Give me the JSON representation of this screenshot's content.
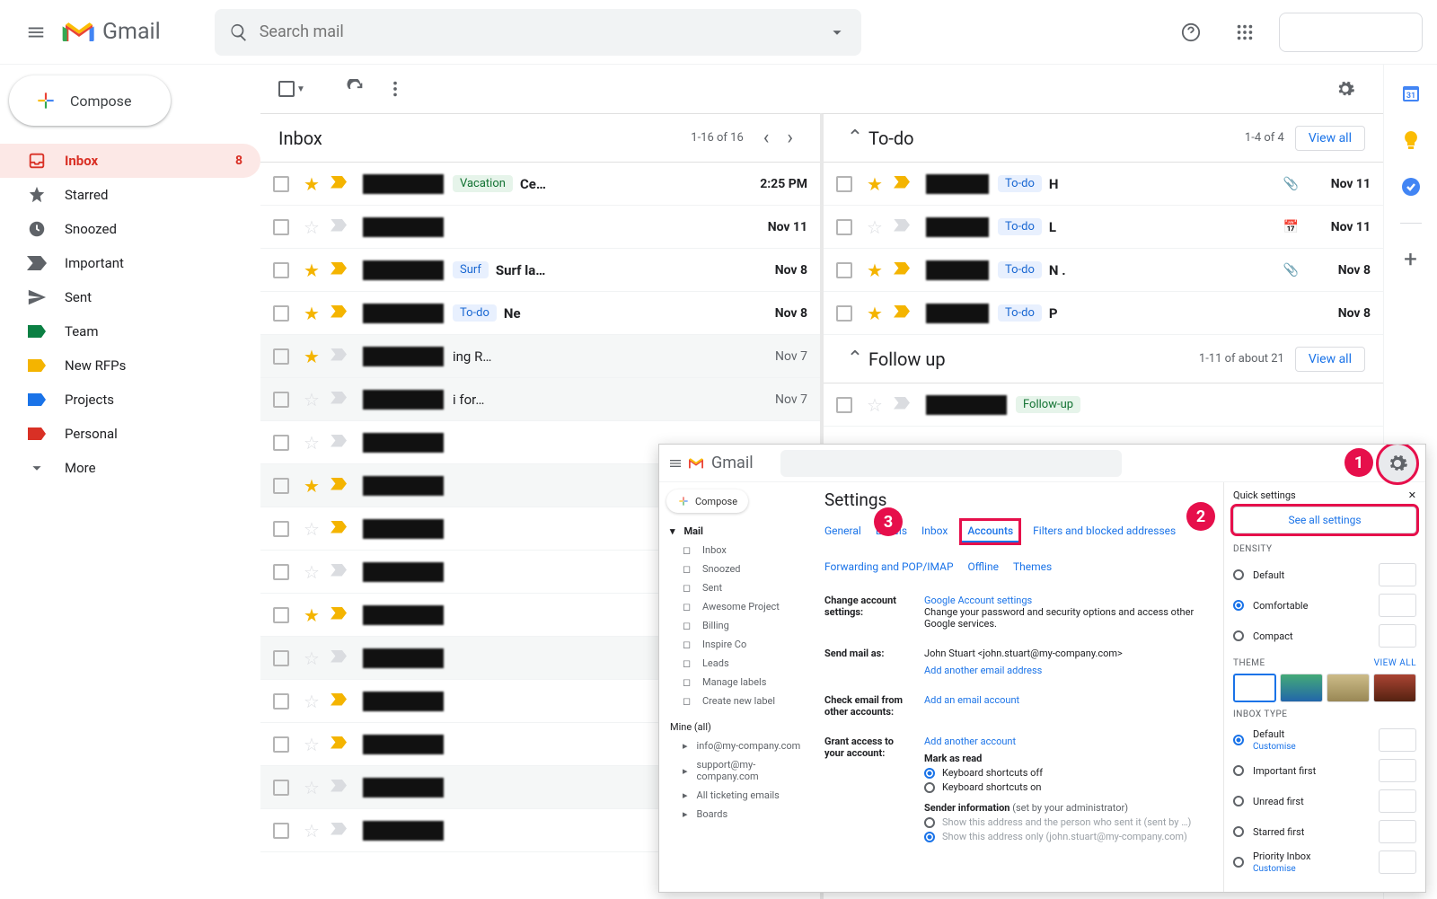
{
  "header": {
    "product_name": "Gmail",
    "search_placeholder": "Search mail"
  },
  "compose_label": "Compose",
  "sidebar": {
    "items": [
      {
        "label": "Inbox",
        "count": "8",
        "active": true,
        "icon": "inbox",
        "color": "#d93025"
      },
      {
        "label": "Starred",
        "icon": "star",
        "color": "#5f6368"
      },
      {
        "label": "Snoozed",
        "icon": "clock",
        "color": "#5f6368"
      },
      {
        "label": "Important",
        "icon": "important",
        "color": "#5f6368"
      },
      {
        "label": "Sent",
        "icon": "send",
        "color": "#5f6368"
      },
      {
        "label": "Team",
        "icon": "label",
        "color": "#0b8043"
      },
      {
        "label": "New RFPs",
        "icon": "label",
        "color": "#f4b400"
      },
      {
        "label": "Projects",
        "icon": "label",
        "color": "#1a73e8"
      },
      {
        "label": "Personal",
        "icon": "label",
        "color": "#d93025"
      },
      {
        "label": "More",
        "icon": "expand",
        "color": "#5f6368"
      }
    ]
  },
  "inbox_section": {
    "title": "Inbox",
    "count": "1-16 of 16",
    "rows": [
      {
        "star": true,
        "imp": true,
        "label": "Vacation",
        "label_bg": "#e6f4ea",
        "label_color": "#137333",
        "subject": "Ce…",
        "date": "2:25 PM",
        "bold": true
      },
      {
        "star": false,
        "imp": false,
        "subject": "",
        "date": "Nov 11",
        "bold": true
      },
      {
        "star": true,
        "imp": true,
        "label": "Surf",
        "label_bg": "#e8f0fe",
        "label_color": "#1967d2",
        "subject": "Surf   la…",
        "date": "Nov 8",
        "bold": true
      },
      {
        "star": true,
        "imp": true,
        "label": "To-do",
        "label_bg": "#e8f0fe",
        "label_color": "#1967d2",
        "subject": "Ne",
        "date": "Nov 8",
        "bold": true
      },
      {
        "star": true,
        "imp": false,
        "subject": "ing R…",
        "date": "Nov 7",
        "bold": false,
        "read": true
      },
      {
        "star": false,
        "imp": false,
        "subject": "i for…",
        "date": "Nov 7",
        "bold": false,
        "read": true
      },
      {
        "star": false,
        "imp": false,
        "subject": "",
        "date": "",
        "bold": true
      },
      {
        "star": true,
        "imp": true,
        "subject": "",
        "date": "",
        "bold": false,
        "read": true
      },
      {
        "star": false,
        "imp": true,
        "subject": "",
        "date": "",
        "bold": true
      },
      {
        "star": false,
        "imp": false,
        "subject": "",
        "date": "",
        "bold": true
      },
      {
        "star": true,
        "imp": true,
        "subject": "",
        "date": "",
        "bold": true
      },
      {
        "star": false,
        "imp": false,
        "subject": "",
        "date": "",
        "bold": false,
        "read": true
      },
      {
        "star": false,
        "imp": true,
        "subject": "",
        "date": "",
        "bold": true
      },
      {
        "star": false,
        "imp": true,
        "subject": "",
        "date": "",
        "bold": true
      },
      {
        "star": false,
        "imp": false,
        "subject": "",
        "date": "",
        "bold": false,
        "read": true
      },
      {
        "star": false,
        "imp": false,
        "subject": "",
        "date": "",
        "bold": true
      }
    ]
  },
  "todo_section": {
    "title": "To-do",
    "count": "1-4 of 4",
    "view_all": "View all",
    "rows": [
      {
        "star": true,
        "imp": true,
        "label": "To-do",
        "subject": "H",
        "att": true,
        "date": "Nov 11"
      },
      {
        "star": false,
        "imp": false,
        "label": "To-do",
        "subject": "L",
        "cal": true,
        "date": "Nov 11"
      },
      {
        "star": true,
        "imp": true,
        "label": "To-do",
        "subject": "N .",
        "att": true,
        "date": "Nov 8"
      },
      {
        "star": true,
        "imp": true,
        "label": "To-do",
        "subject": "P",
        "date": "Nov 8"
      }
    ]
  },
  "followup_section": {
    "title": "Follow up",
    "count": "1-11 of about 21",
    "view_all": "View all",
    "row_label": "Follow-up"
  },
  "overlay": {
    "product_name": "Gmail",
    "compose": "Compose",
    "mail_label": "Mail",
    "sidebar_items": [
      "Inbox",
      "Snoozed",
      "Sent",
      "Awesome Project",
      "Billing",
      "Inspire Co",
      "Leads",
      "Manage labels",
      "Create new label"
    ],
    "mine_all": "Mine (all)",
    "mine_items": [
      "info@my-company.com",
      "support@my-company.com",
      "All ticketing emails",
      "Boards"
    ],
    "settings_title": "Settings",
    "tabs": [
      "General",
      "Labels",
      "Inbox",
      "Accounts",
      "Filters and blocked addresses",
      "Forwarding and POP/IMAP",
      "Offline",
      "Themes"
    ],
    "active_tab": "Accounts",
    "sections": {
      "change_account": {
        "label": "Change account settings:",
        "link": "Google Account settings",
        "desc": "Change your password and security options and access other Google services."
      },
      "send_mail_as": {
        "label": "Send mail as:",
        "value": "John Stuart <john.stuart@my-company.com>",
        "link": "Add another email address"
      },
      "check_email": {
        "label": "Check email from other accounts:",
        "link": "Add an email account"
      },
      "grant_access": {
        "label": "Grant access to your account:",
        "link": "Add another account",
        "mark_as_read": "Mark as read",
        "shortcuts_off": "Keyboard shortcuts off",
        "shortcuts_on": "Keyboard shortcuts on"
      },
      "sender_info": {
        "label": "Sender information",
        "suffix": "(set by your administrator)",
        "opt1": "Show this address and the person who sent it (sent by …)",
        "opt2": "Show this address only (john.stuart@my-company.com)"
      }
    },
    "quick_settings": {
      "title": "Quick settings",
      "see_all": "See all settings",
      "density_title": "DENSITY",
      "density": [
        "Default",
        "Comfortable",
        "Compact"
      ],
      "density_selected": "Comfortable",
      "theme_title": "THEME",
      "view_all": "View all",
      "inbox_type_title": "INBOX TYPE",
      "inbox_types": [
        {
          "label": "Default",
          "sub": "Customise",
          "selected": true
        },
        {
          "label": "Important first"
        },
        {
          "label": "Unread first"
        },
        {
          "label": "Starred first"
        },
        {
          "label": "Priority Inbox",
          "sub": "Customise"
        }
      ]
    }
  },
  "callout1": "1",
  "callout2": "2",
  "callout3": "3"
}
